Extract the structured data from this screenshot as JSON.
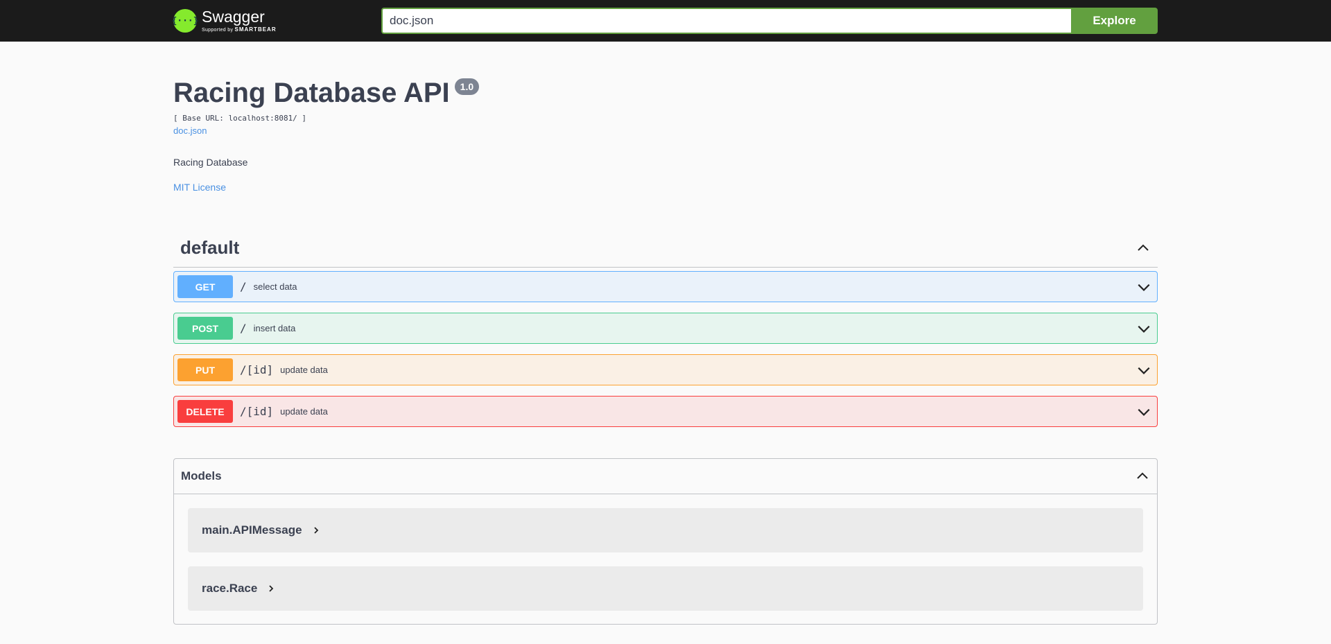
{
  "topbar": {
    "logo_name": "Swagger",
    "logo_sub_prefix": "Supported by",
    "logo_sub_brand": "SMARTBEAR",
    "logo_glyph": "{···}",
    "search_value": "doc.json",
    "explore_label": "Explore",
    "accent_color": "#62a03f"
  },
  "info": {
    "title": "Racing Database API",
    "version": "1.0",
    "base_url": "[ Base URL: localhost:8081/ ]",
    "doc_link": "doc.json",
    "description": "Racing Database",
    "license": "MIT License"
  },
  "tag": {
    "name": "default",
    "operations": [
      {
        "method": "GET",
        "path": "/",
        "summary": "select data",
        "color": "#61affe"
      },
      {
        "method": "POST",
        "path": "/",
        "summary": "insert data",
        "color": "#49cc90"
      },
      {
        "method": "PUT",
        "path": "/[id]",
        "summary": "update data",
        "color": "#fca130"
      },
      {
        "method": "DELETE",
        "path": "/[id]",
        "summary": "update data",
        "color": "#f93e3e"
      }
    ]
  },
  "models": {
    "title": "Models",
    "items": [
      {
        "name": "main.APIMessage"
      },
      {
        "name": "race.Race"
      }
    ]
  },
  "icons": [
    "swagger-logo-icon",
    "chevron-up-icon",
    "chevron-down-icon",
    "chevron-right-icon"
  ]
}
